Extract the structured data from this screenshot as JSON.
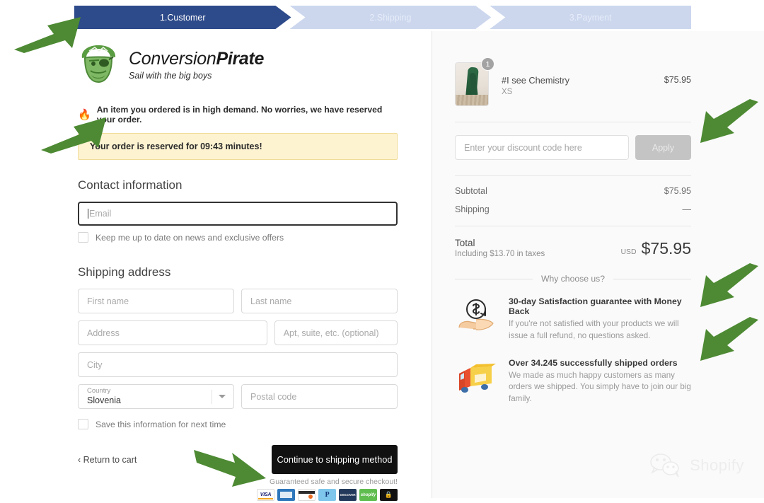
{
  "progress": {
    "steps": [
      {
        "label": "1.Customer",
        "state": "active"
      },
      {
        "label": "2.Shipping",
        "state": "inactive"
      },
      {
        "label": "3.Payment",
        "state": "inactive"
      }
    ],
    "active_color": "#2d4a8a",
    "inactive_color": "#ccd7ee"
  },
  "brand": {
    "name_part1": "Conversion",
    "name_part2": "Pirate",
    "tagline": "Sail with the big boys",
    "logo_icon": "pirate-face-icon",
    "logo_color": "#5a9c41"
  },
  "urgency": {
    "icon": "flame-icon",
    "message": "An item you ordered is in high demand. No worries, we have reserved your order.",
    "banner_text": "Your order is reserved for 09:43 minutes!",
    "banner_bg": "#fdf3d1",
    "banner_border": "#f0dc9a"
  },
  "contact": {
    "title": "Contact information",
    "email_placeholder": "Email",
    "email_value": "",
    "newsletter_label": "Keep me up to date on news and exclusive offers",
    "newsletter_checked": false
  },
  "shipping": {
    "title": "Shipping address",
    "first_name_placeholder": "First name",
    "last_name_placeholder": "Last name",
    "address_placeholder": "Address",
    "apt_placeholder": "Apt, suite, etc. (optional)",
    "city_placeholder": "City",
    "country_label": "Country",
    "country_value": "Slovenia",
    "postal_placeholder": "Postal code",
    "save_info_label": "Save this information for next time",
    "save_info_checked": false
  },
  "actions": {
    "return_to_cart": "Return to cart",
    "return_icon": "chevron-left-icon",
    "continue_label": "Continue to shipping method",
    "secure_text": "Guaranteed safe and secure checkout!",
    "payment_icons": [
      "visa-icon",
      "amex-icon",
      "mastercard-icon",
      "paypal-icon",
      "discover-icon",
      "shopify-pay-icon",
      "secure-lock-icon"
    ]
  },
  "summary": {
    "item": {
      "name": "#I see Chemistry",
      "variant": "XS",
      "price": "$75.95",
      "quantity": "1",
      "thumb_icon": "product-thumbnail-green-leggings"
    },
    "discount": {
      "placeholder": "Enter your discount code here",
      "value": "",
      "apply_label": "Apply"
    },
    "totals": [
      {
        "label": "Subtotal",
        "value": "$75.95"
      },
      {
        "label": "Shipping",
        "value": "—"
      }
    ],
    "grand_total": {
      "label": "Total",
      "sub_label": "Including $13.70 in taxes",
      "currency": "USD",
      "amount": "$75.95"
    },
    "why_title": "Why choose us?",
    "trust_badges": [
      {
        "icon": "money-back-hand-icon",
        "title": "30-day Satisfaction guarantee with Money Back",
        "body": "If you're not satisfied with your products we will issue a full refund, no questions asked."
      },
      {
        "icon": "delivery-truck-icon",
        "title": "Over 34.245 successfully shipped orders",
        "body": "We made as much happy customers as many orders we shipped. You simply have to join our big family."
      }
    ]
  },
  "watermark": {
    "icon": "wechat-bubbles-icon",
    "text": "Shopify"
  },
  "annotations": {
    "arrow_color": "#4d8a33",
    "count": 6
  }
}
